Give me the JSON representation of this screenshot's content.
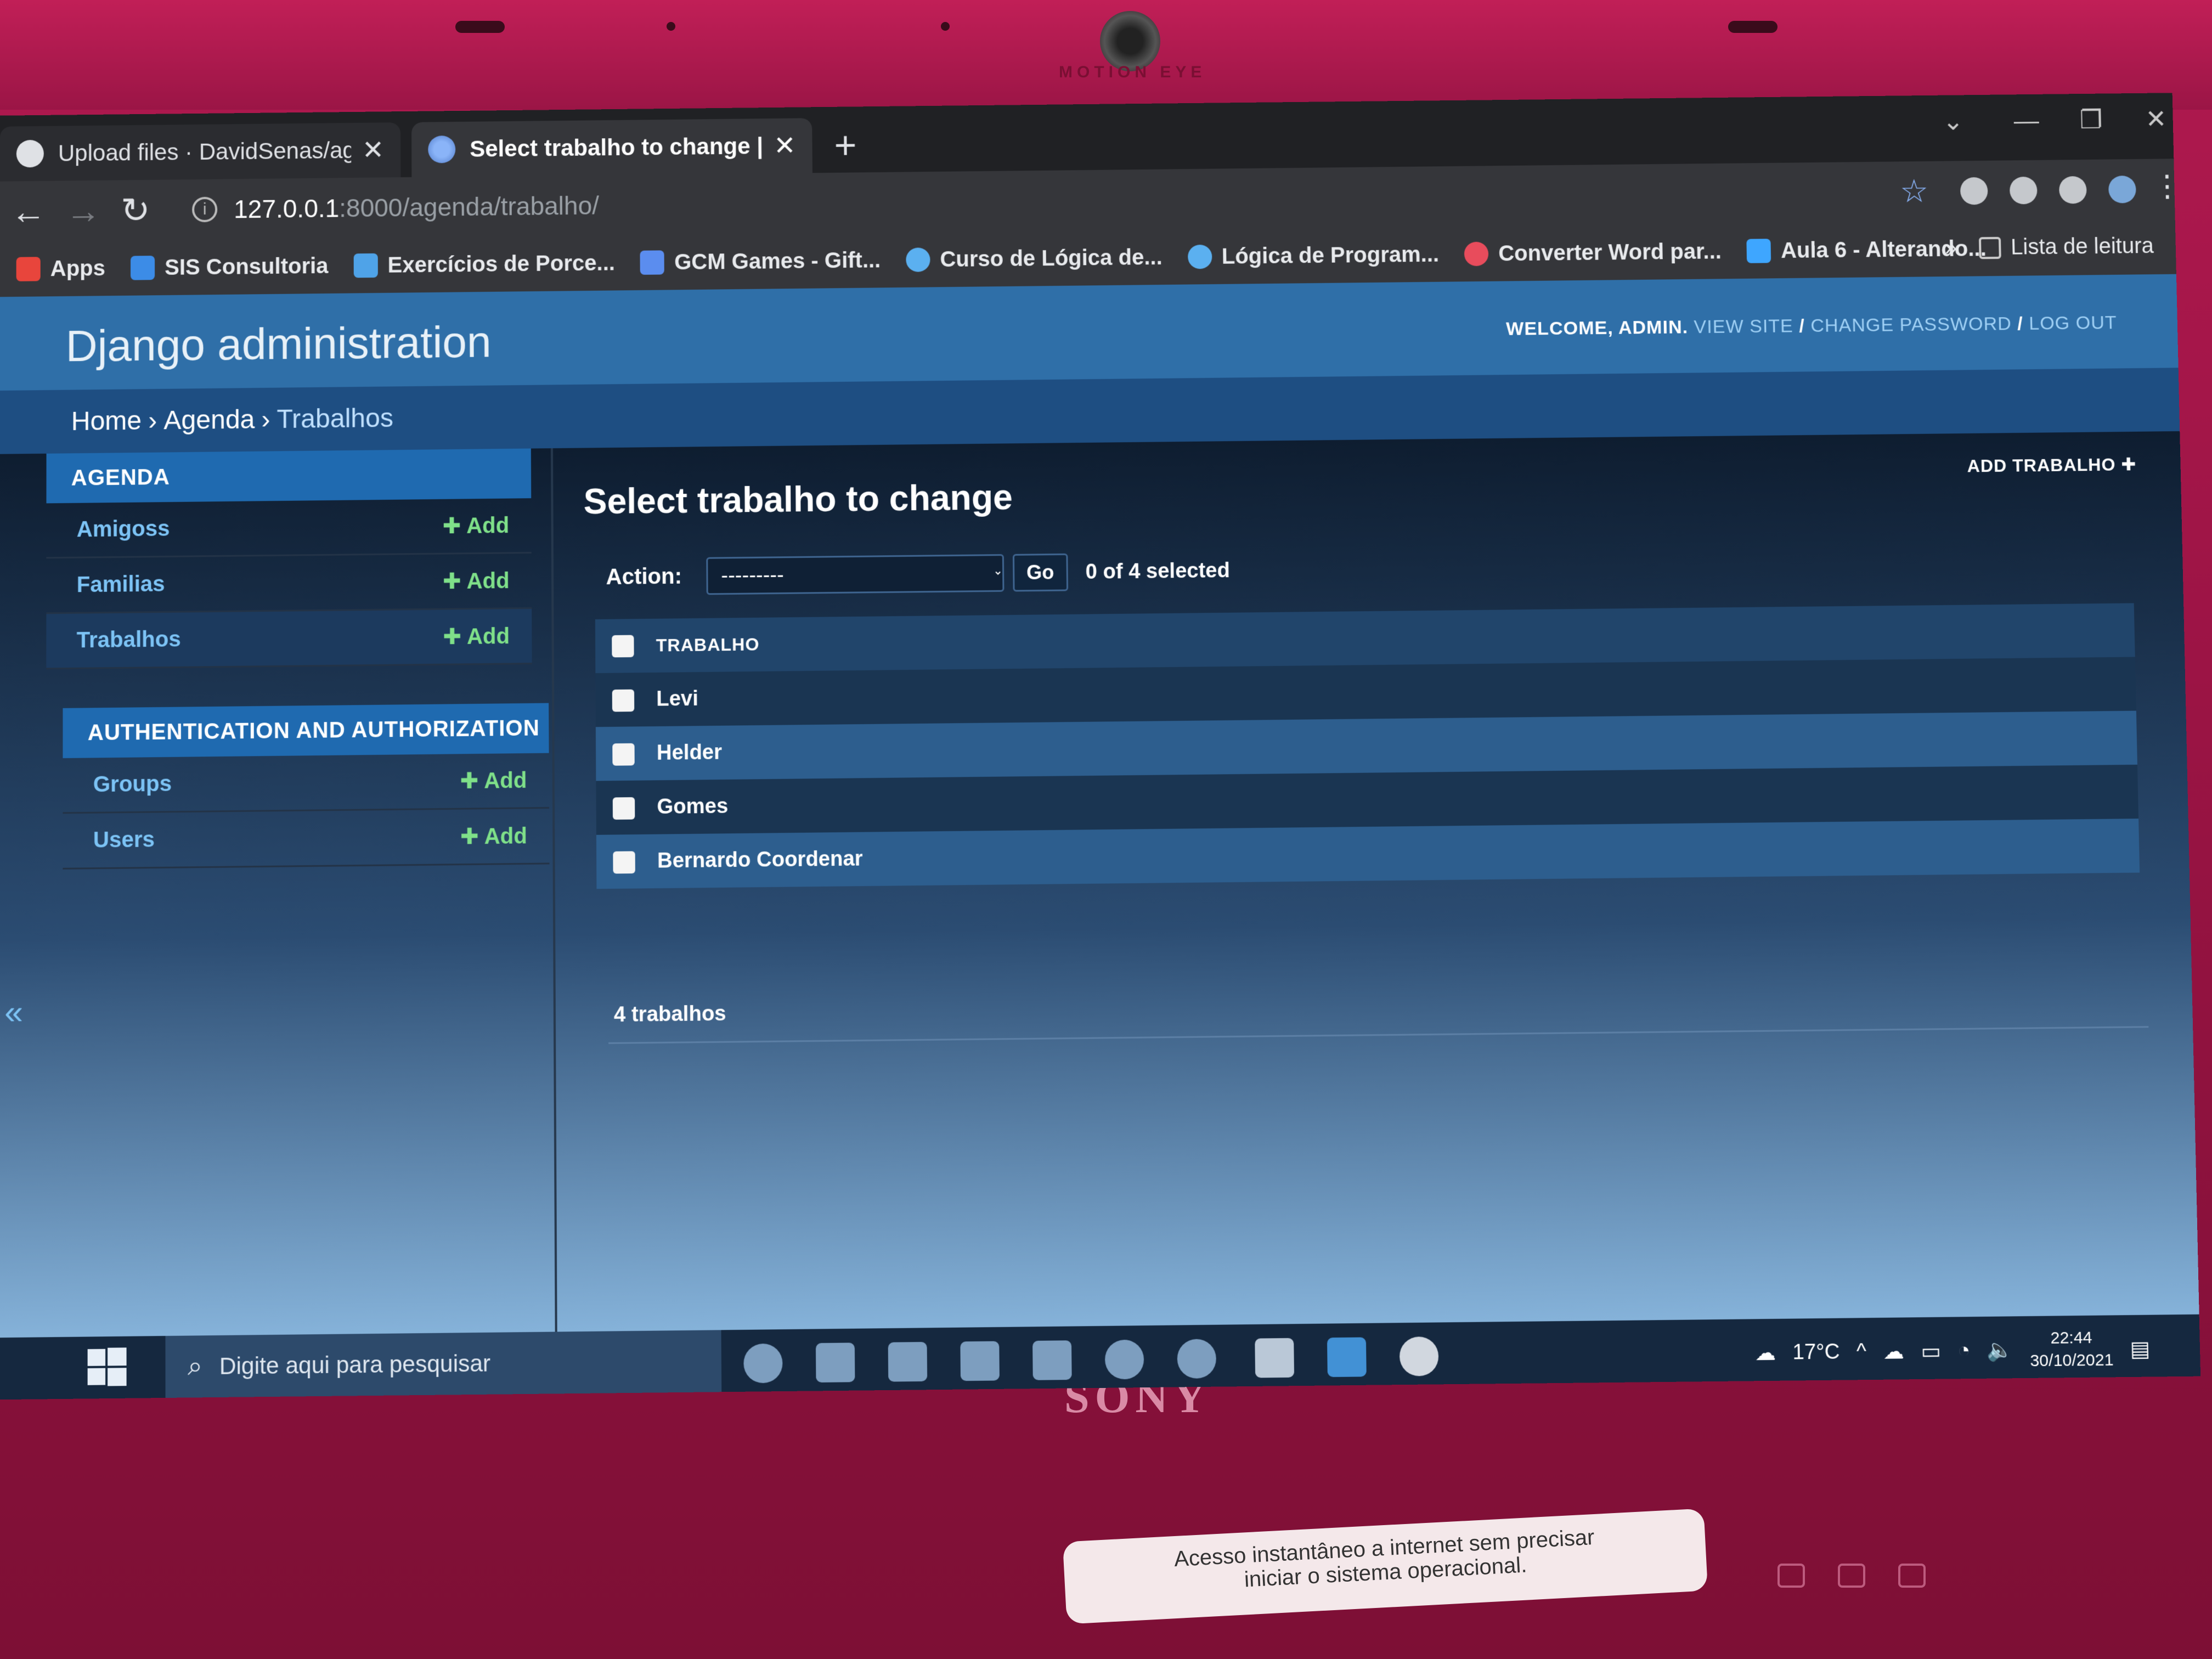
{
  "laptop": {
    "brand": "SONY",
    "camera_label": "MOTION EYE",
    "sticker_line1": "Acesso instantâneo a internet sem precisar",
    "sticker_line2": "iniciar o sistema operacional."
  },
  "browser": {
    "tabs": [
      {
        "label": "Upload files · DavidSenas/agen",
        "active": false
      },
      {
        "label": "Select trabalho to change | Djan",
        "active": true
      }
    ],
    "address": {
      "host": "127.0.0.1",
      "path": ":8000/agenda/trabalho/"
    },
    "bookmarks": [
      {
        "label": "Apps",
        "icon": "apps-grid-icon",
        "color": "#e8453c"
      },
      {
        "label": "SIS Consultoria",
        "icon": "sis-icon",
        "color": "#3c8ce7"
      },
      {
        "label": "Exercícios de Porce...",
        "icon": "globe-icon",
        "color": "#4fa3e8"
      },
      {
        "label": "GCM Games - Gift...",
        "icon": "gcm-icon",
        "color": "#5b8def"
      },
      {
        "label": "Curso de Lógica de...",
        "icon": "edge-icon",
        "color": "#5bb0f0"
      },
      {
        "label": "Lógica de Program...",
        "icon": "edge-icon",
        "color": "#5bb0f0"
      },
      {
        "label": "Converter Word par...",
        "icon": "heart-icon",
        "color": "#e84c5c"
      },
      {
        "label": "Aula 6 - Alterando...",
        "icon": "video-icon",
        "color": "#3ea6ff"
      }
    ],
    "reading_list": "Lista de leitura"
  },
  "django": {
    "site_title": "Django administration",
    "user_tools": {
      "welcome": "WELCOME,",
      "user": "ADMIN",
      "view_site": "VIEW SITE",
      "change_password": "CHANGE PASSWORD",
      "logout": "LOG OUT"
    },
    "breadcrumbs": {
      "home": "Home",
      "app": "Agenda",
      "current": "Trabalhos"
    },
    "sidebar": {
      "modules": [
        {
          "caption": "AGENDA",
          "models": [
            {
              "name": "Amigoss",
              "add": "Add"
            },
            {
              "name": "Familias",
              "add": "Add"
            },
            {
              "name": "Trabalhos",
              "add": "Add"
            }
          ]
        },
        {
          "caption": "AUTHENTICATION AND AUTHORIZATION",
          "models": [
            {
              "name": "Groups",
              "add": "Add"
            },
            {
              "name": "Users",
              "add": "Add"
            }
          ]
        }
      ],
      "collapse": "«"
    },
    "content": {
      "title": "Select trabalho to change",
      "add_link": "ADD TRABALHO",
      "action_label": "Action:",
      "action_selected": "---------",
      "go": "Go",
      "selection_count": "0 of 4 selected",
      "column_header": "TRABALHO",
      "rows": [
        "Levi",
        "Helder",
        "Gomes",
        "Bernardo Coordenar"
      ],
      "paginator": "4 trabalhos"
    }
  },
  "taskbar": {
    "search_placeholder": "Digite aqui para pesquisar",
    "temperature": "17°C",
    "time": "22:44",
    "date": "30/10/2021"
  }
}
